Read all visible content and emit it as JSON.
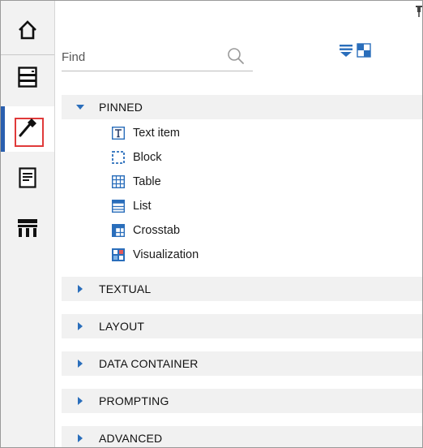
{
  "toolbox": {
    "search": {
      "placeholder": "Find",
      "value": ""
    },
    "sections": [
      {
        "label": "PINNED",
        "expanded": true,
        "items": [
          {
            "label": "Text item",
            "icon": "text-item-icon"
          },
          {
            "label": "Block",
            "icon": "block-icon"
          },
          {
            "label": "Table",
            "icon": "table-icon"
          },
          {
            "label": "List",
            "icon": "list-icon"
          },
          {
            "label": "Crosstab",
            "icon": "crosstab-icon"
          },
          {
            "label": "Visualization",
            "icon": "visualization-icon"
          }
        ]
      },
      {
        "label": "TEXTUAL",
        "expanded": false
      },
      {
        "label": "LAYOUT",
        "expanded": false
      },
      {
        "label": "DATA CONTAINER",
        "expanded": false
      },
      {
        "label": "PROMPTING",
        "expanded": false
      },
      {
        "label": "ADVANCED",
        "expanded": false
      }
    ]
  },
  "rail": {
    "buttons": [
      "home-icon",
      "data-source-icon",
      "toolbox-icon",
      "pages-icon",
      "report-objects-icon"
    ],
    "active": "toolbox-icon"
  },
  "colors": {
    "accent_blue": "#2a6ebb",
    "active_highlight": "#e03a3a",
    "section_bg": "#f1f1f1",
    "rail_bg": "#f2f2f2"
  }
}
